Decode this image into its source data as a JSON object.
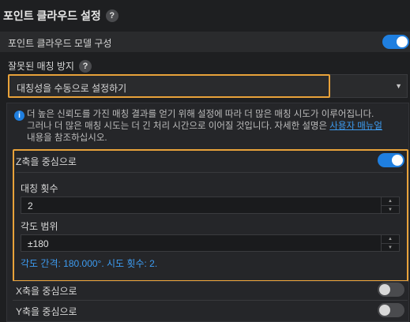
{
  "header": {
    "title": "포인트 클라우드 설정",
    "help": "?"
  },
  "model_config": {
    "label": "포인트 클라우드 모델 구성",
    "enabled": true
  },
  "mismatch": {
    "label": "잘못된 매칭 방지",
    "help": "?",
    "selected": "대칭성을 수동으로 설정하기"
  },
  "info": {
    "icon": "i",
    "text_line1": "더 높은 신뢰도를 가진 매칭 결과를 얻기 위해 설정에 따라 더 많은 매칭 시도가 이루어집니다.",
    "text_line2": "그러나 더 많은 매칭 시도는 더 긴 처리 시간으로 이어질 것입니다. 자세한 설명은 ",
    "link": "사용자 매뉴얼",
    "text_line3": "내용을 참조하십시오."
  },
  "z_axis": {
    "label": "Z축을 중심으로",
    "enabled": true,
    "count_label": "대칭 횟수",
    "count_value": "2",
    "range_label": "각도 범위",
    "range_value": "±180",
    "note": "각도 간격: 180.000°. 시도 횟수: 2."
  },
  "x_axis": {
    "label": "X축을 중심으로",
    "enabled": false
  },
  "y_axis": {
    "label": "Y축을 중심으로",
    "enabled": false
  },
  "colors": {
    "accent": "#1f7fe0",
    "highlight": "#e8a23a",
    "link": "#3d9bf0"
  }
}
